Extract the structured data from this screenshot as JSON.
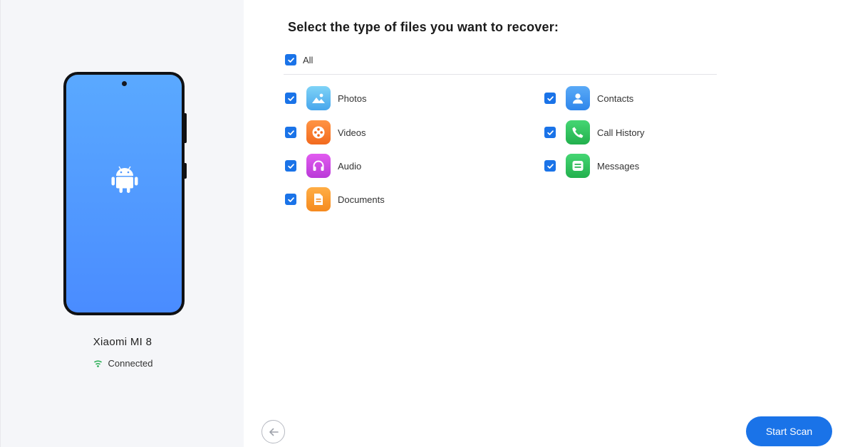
{
  "device": {
    "name": "Xiaomi MI 8",
    "status": "Connected",
    "status_icon": "wifi-icon",
    "os_icon": "android-icon"
  },
  "main": {
    "title": "Select the type of files you want to recover:",
    "all": {
      "label": "All",
      "checked": true
    },
    "options": [
      {
        "label": "Photos",
        "icon": "photos-icon",
        "color": "#5bb8f0",
        "checked": true
      },
      {
        "label": "Videos",
        "icon": "videos-icon",
        "color": "#f47a2a",
        "checked": true
      },
      {
        "label": "Audio",
        "icon": "audio-icon",
        "color": "#d04ce0",
        "checked": true
      },
      {
        "label": "Documents",
        "icon": "documents-icon",
        "color": "#f59b2e",
        "checked": true
      },
      {
        "label": "Contacts",
        "icon": "contacts-icon",
        "color": "#3e94f0",
        "checked": true
      },
      {
        "label": "Call History",
        "icon": "call-history-icon",
        "color": "#2fc55c",
        "checked": true
      },
      {
        "label": "Messages",
        "icon": "messages-icon",
        "color": "#2fc55c",
        "checked": true
      }
    ]
  },
  "footer": {
    "back_icon": "arrow-left-icon",
    "start_label": "Start Scan"
  },
  "colors": {
    "accent": "#1a73e8",
    "panel_bg": "#f5f6f9"
  }
}
